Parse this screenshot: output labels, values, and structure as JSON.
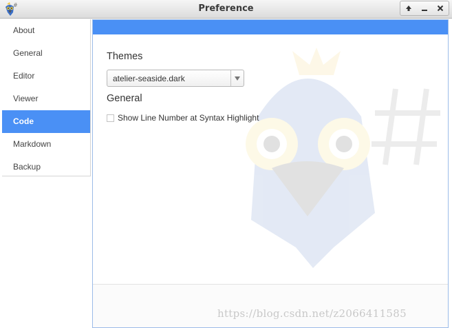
{
  "window": {
    "title": "Preference",
    "controls": {
      "maximize": "up-arrow-icon",
      "minimize": "minimize-icon",
      "close": "close-icon"
    }
  },
  "sidebar": {
    "items": [
      {
        "label": "About"
      },
      {
        "label": "General"
      },
      {
        "label": "Editor"
      },
      {
        "label": "Viewer"
      },
      {
        "label": "Code",
        "active": true
      },
      {
        "label": "Markdown"
      },
      {
        "label": "Backup"
      }
    ]
  },
  "content": {
    "themes": {
      "heading": "Themes",
      "selected_value": "atelier-seaside.dark"
    },
    "general": {
      "heading": "General",
      "checkbox_label": "Show Line Number at Syntax Highlight",
      "checked": false
    }
  },
  "watermark_text": "https://blog.csdn.net/z2066411585",
  "colors": {
    "accent": "#4a90f5",
    "titlebar": "#e6e6e6",
    "watermark": "#c8c8c8"
  }
}
